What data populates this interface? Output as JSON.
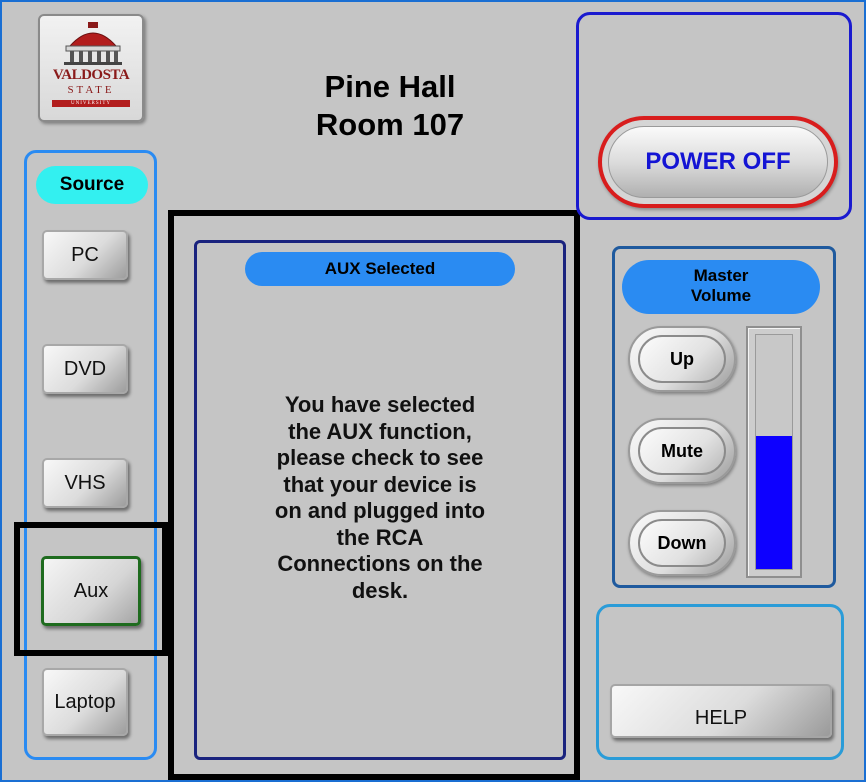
{
  "logo": {
    "name": "VALDOSTA",
    "sub": "STATE",
    "band": "UNIVERSITY"
  },
  "room": {
    "building": "Pine Hall",
    "room": "Room 107"
  },
  "source": {
    "label": "Source",
    "buttons": [
      {
        "id": "pc",
        "label": "PC"
      },
      {
        "id": "dvd",
        "label": "DVD"
      },
      {
        "id": "vhs",
        "label": "VHS"
      },
      {
        "id": "aux",
        "label": "Aux",
        "selected": true
      },
      {
        "id": "laptop",
        "label": "Laptop"
      }
    ]
  },
  "info": {
    "status": "AUX Selected",
    "message_lines": [
      "You have selected",
      "the AUX function,",
      "please check to see",
      "that your device is",
      "on and plugged into",
      "the RCA",
      "Connections on the",
      "desk."
    ]
  },
  "power": {
    "label": "POWER OFF"
  },
  "volume": {
    "label_line1": "Master",
    "label_line2": "Volume",
    "up": "Up",
    "mute": "Mute",
    "down": "Down",
    "level_fraction": 0.57
  },
  "help": {
    "label": "HELP"
  },
  "colors": {
    "accent_blue": "#2a8bf2",
    "source_label": "#33f0f0",
    "power_ring": "#d81d1d",
    "power_text": "#1414d4",
    "meter_fill": "#0d00ff",
    "selected_border": "#1e6b1e",
    "background": "#c5c5c5"
  }
}
